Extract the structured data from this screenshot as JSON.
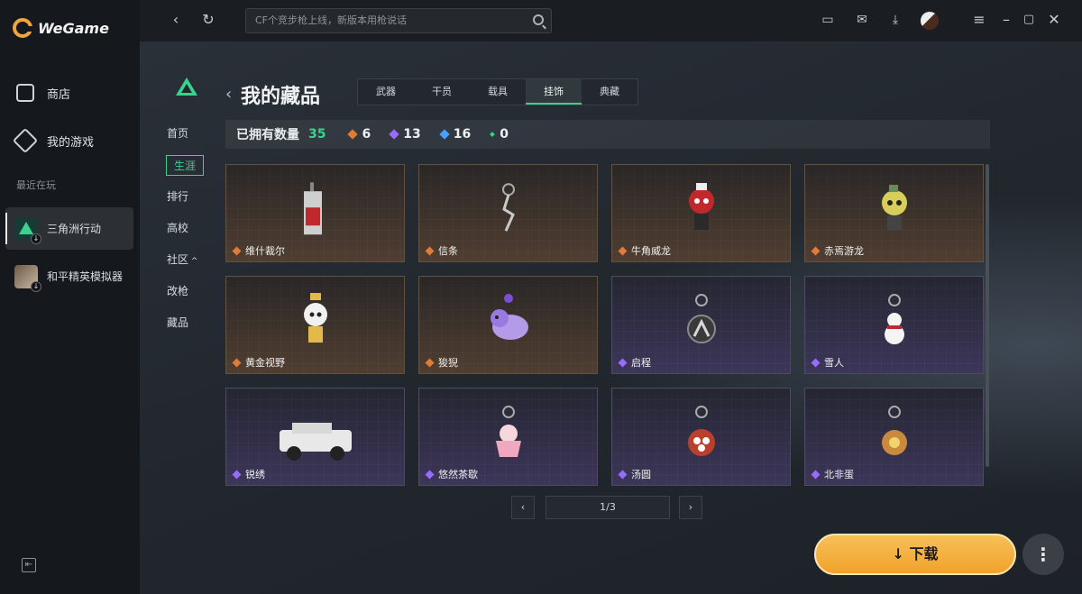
{
  "app": {
    "brand": "WeGame"
  },
  "sidebar": {
    "nav": [
      {
        "label": "商店",
        "icon": "store-icon"
      },
      {
        "label": "我的游戏",
        "icon": "gamepad-icon"
      }
    ],
    "recent_label": "最近在玩",
    "recent_games": [
      {
        "label": "三角洲行动",
        "active": true
      },
      {
        "label": "和平精英模拟器",
        "active": false
      }
    ]
  },
  "topbar": {
    "search_placeholder": "CF个竞步枪上线，新版本用枪说话",
    "icons": [
      "back-icon",
      "refresh-icon",
      "message-icon",
      "mail-icon",
      "download-manager-icon",
      "avatar",
      "menu-icon",
      "minimize-icon",
      "maximize-icon",
      "close-icon"
    ]
  },
  "subnav": [
    "首页",
    "生涯",
    "排行",
    "高校",
    "社区",
    "改枪",
    "藏品"
  ],
  "subnav_active": "生涯",
  "page": {
    "title": "我的藏品"
  },
  "tabs": [
    {
      "label": "武器",
      "active": false
    },
    {
      "label": "干员",
      "active": false
    },
    {
      "label": "载具",
      "active": false
    },
    {
      "label": "挂饰",
      "active": true
    },
    {
      "label": "典藏",
      "active": false
    }
  ],
  "stats": {
    "label": "已拥有数量",
    "total": "35",
    "by_rarity": [
      {
        "count": "6",
        "color": "#e07b3a"
      },
      {
        "count": "13",
        "color": "#9a6bff"
      },
      {
        "count": "16",
        "color": "#4aa0ff"
      },
      {
        "count": "0",
        "color": "#37d38f"
      }
    ]
  },
  "items": [
    {
      "name": "维什裁尔",
      "rarity": "gold"
    },
    {
      "name": "信条",
      "rarity": "gold"
    },
    {
      "name": "牛角威龙",
      "rarity": "gold"
    },
    {
      "name": "赤焉游龙",
      "rarity": "gold"
    },
    {
      "name": "黄金视野",
      "rarity": "gold"
    },
    {
      "name": "狻猊",
      "rarity": "gold"
    },
    {
      "name": "启程",
      "rarity": "purple"
    },
    {
      "name": "雪人",
      "rarity": "purple"
    },
    {
      "name": "锐绣",
      "rarity": "purple"
    },
    {
      "name": "悠然茶歇",
      "rarity": "purple"
    },
    {
      "name": "汤圆",
      "rarity": "purple"
    },
    {
      "name": "北非蛋",
      "rarity": "purple"
    }
  ],
  "pagination": {
    "text": "1/3"
  },
  "actions": {
    "download_label": "下载",
    "more_label": "⋮"
  },
  "colors": {
    "accent": "#37d38f",
    "gold": "#e07b3a",
    "purple": "#9a6bff",
    "download": "#f1a22a"
  }
}
